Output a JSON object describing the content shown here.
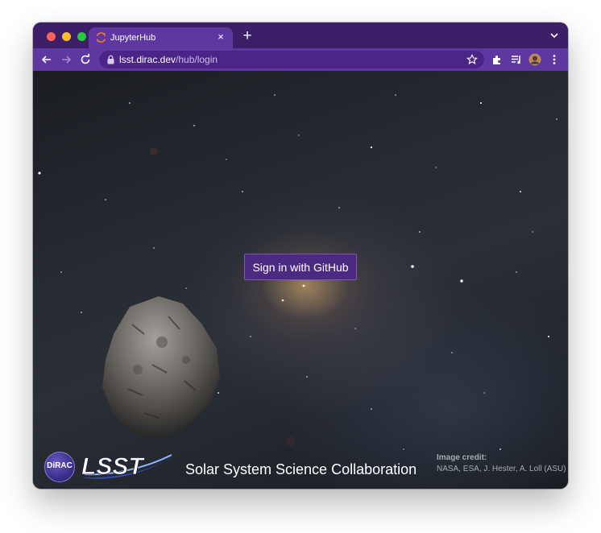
{
  "browser": {
    "tab": {
      "title": "JupyterHub",
      "close_label": "×"
    },
    "new_tab_label": "+",
    "address_bar": {
      "host": "lsst.dirac.dev",
      "path": "/hub/login"
    },
    "colors": {
      "frame": "#3c1f67",
      "toolbar": "#5f37a0",
      "omnibox": "#4a2587"
    }
  },
  "page": {
    "sign_in_button": "Sign in with GitHub",
    "dirac_logo_text": "DiRAC",
    "lsst_logo_text": "LSST",
    "collaboration_title": "Solar System Science Collaboration",
    "image_credit": {
      "title": "Image credit:",
      "body": "NASA, ESA, J. Hester, A. Loll (ASU)"
    },
    "colors": {
      "button": "#4b2a82",
      "button_border": "#7a5ab5"
    }
  },
  "icons": [
    "jupyter-icon",
    "back-icon",
    "forward-icon",
    "reload-icon",
    "lock-icon",
    "bookmark-star-icon",
    "extensions-icon",
    "media-icon",
    "profile-avatar",
    "more-icon",
    "chevron-down-icon"
  ]
}
